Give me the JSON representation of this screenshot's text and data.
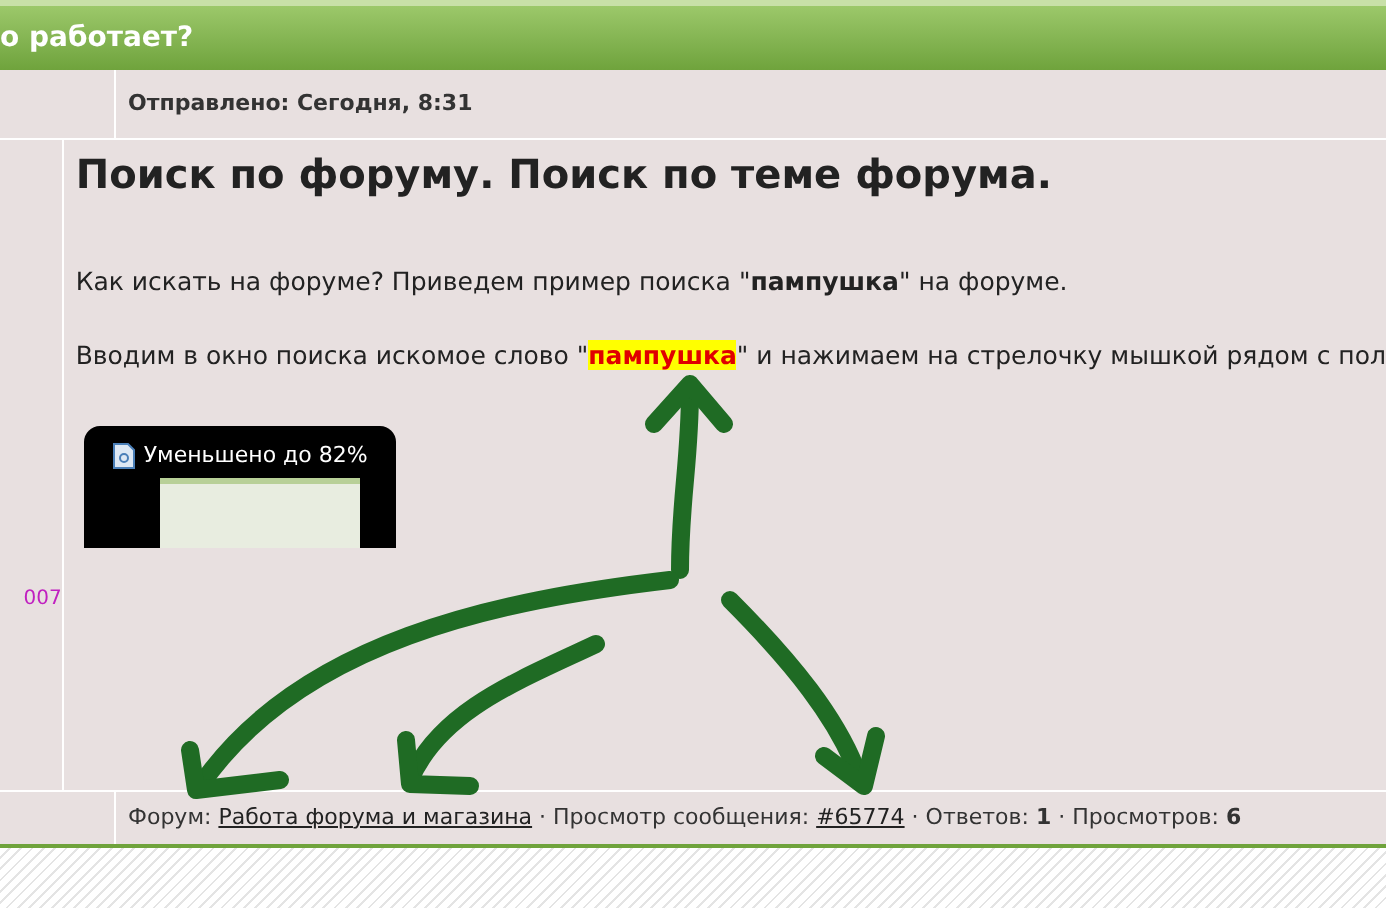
{
  "topic_title": "о работает?",
  "posted": "Отправлено: Сегодня, 8:31",
  "author_fragment": "007",
  "post": {
    "heading": "Поиск по форуму. Поиск по теме форума.",
    "paragraph_1": "Как искать на форуме? Приведем пример поиска \"**пампушка**\" на форуме.",
    "paragraph_2": [
      {
        "kind": "text",
        "text": "Вводим в окно поиска искомое слово \""
      },
      {
        "kind": "highlight",
        "text": "пампушка"
      },
      {
        "kind": "text",
        "text": "\" и нажимаем на стрелочку мышкой рядом с пол"
      }
    ],
    "thumbnail": {
      "caption": "Уменьшено до 82%"
    }
  },
  "footer": [
    {
      "kind": "text",
      "text": "Форум: "
    },
    {
      "kind": "link",
      "text": "Работа форума и магазина"
    },
    {
      "kind": "text",
      "text": " · Просмотр сообщения: "
    },
    {
      "kind": "link",
      "text": "#65774"
    },
    {
      "kind": "text",
      "text": " · Ответов: "
    },
    {
      "kind": "bold",
      "text": "1"
    },
    {
      "kind": "text",
      "text": " · Просмотров: "
    },
    {
      "kind": "bold",
      "text": "6"
    }
  ]
}
